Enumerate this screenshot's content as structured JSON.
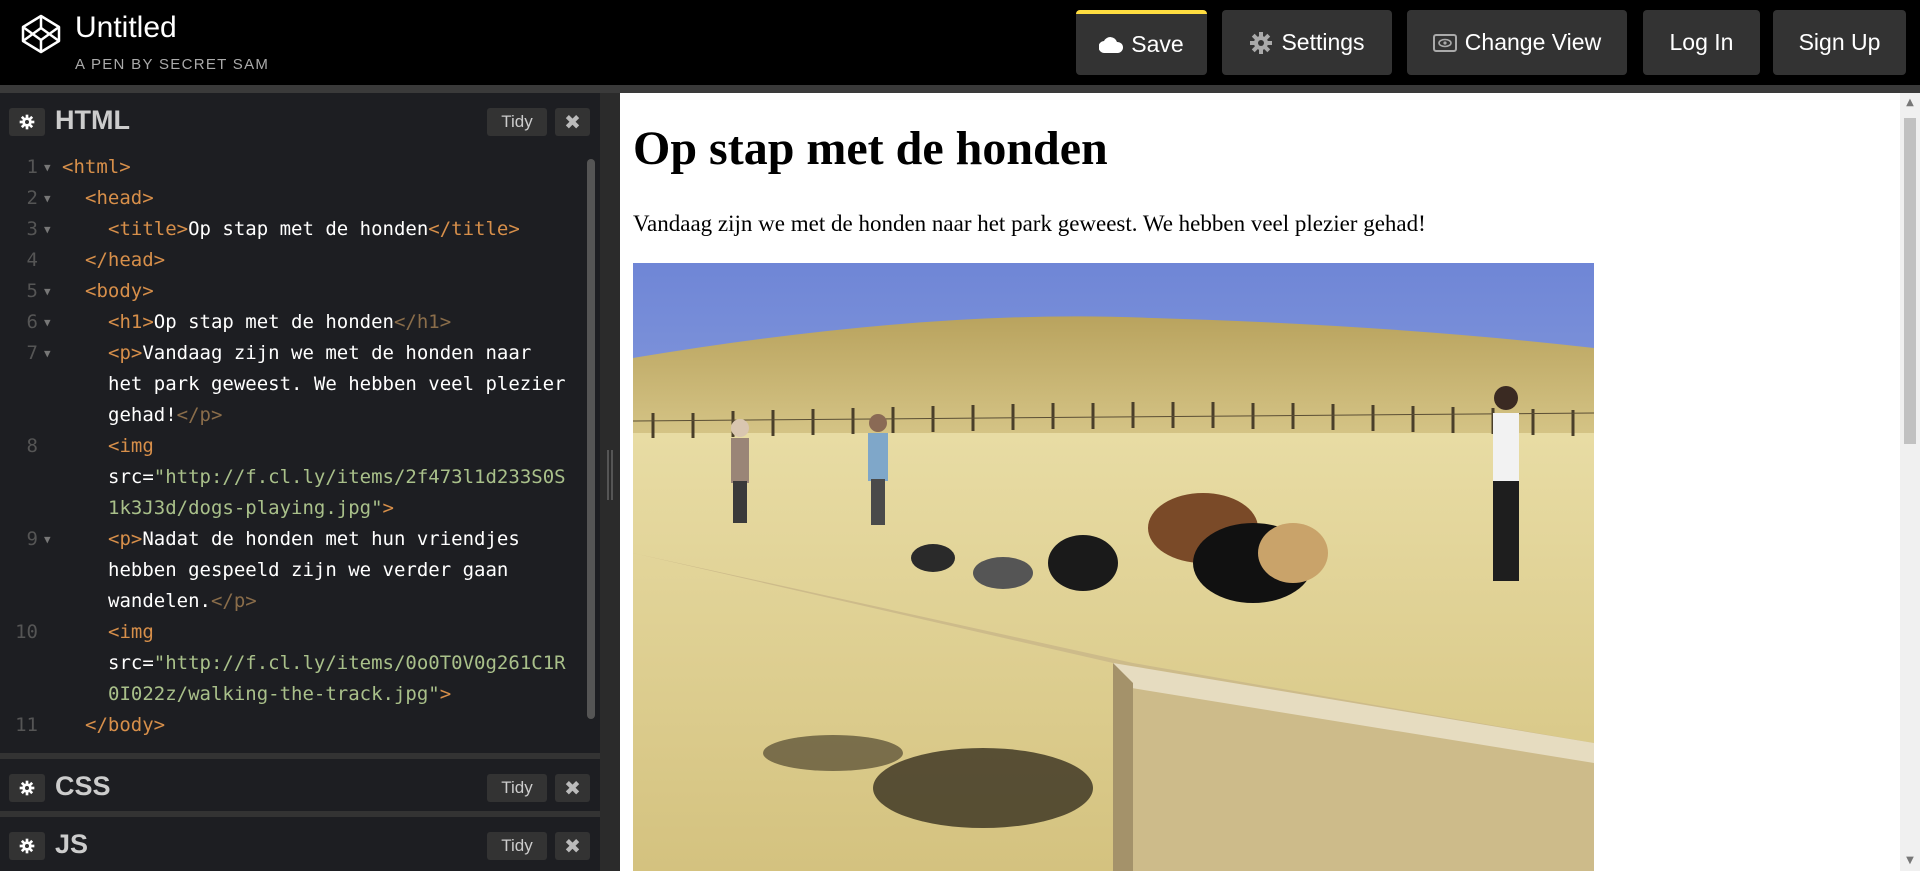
{
  "header": {
    "title": "Untitled",
    "subtitle": "A PEN BY SECRET SAM",
    "buttons": {
      "save": "Save",
      "settings": "Settings",
      "change_view": "Change View",
      "login": "Log In",
      "signup": "Sign Up"
    }
  },
  "editors": {
    "html": {
      "name": "HTML",
      "tidy": "Tidy",
      "close": "✖"
    },
    "css": {
      "name": "CSS",
      "tidy": "Tidy",
      "close": "✖"
    },
    "js": {
      "name": "JS",
      "tidy": "Tidy",
      "close": "✖"
    }
  },
  "code_lines": [
    {
      "n": "1",
      "fold": true
    },
    {
      "n": "2",
      "fold": true
    },
    {
      "n": "3",
      "fold": true
    },
    {
      "n": "4",
      "fold": false
    },
    {
      "n": "5",
      "fold": true
    },
    {
      "n": "6",
      "fold": true
    },
    {
      "n": "7",
      "fold": true
    },
    {
      "n": "",
      "fold": false
    },
    {
      "n": "",
      "fold": false
    },
    {
      "n": "8",
      "fold": false
    },
    {
      "n": "",
      "fold": false
    },
    {
      "n": "",
      "fold": false
    },
    {
      "n": "9",
      "fold": true
    },
    {
      "n": "",
      "fold": false
    },
    {
      "n": "",
      "fold": false
    },
    {
      "n": "10",
      "fold": false
    },
    {
      "n": "",
      "fold": false
    },
    {
      "n": "",
      "fold": false
    },
    {
      "n": "11",
      "fold": false
    }
  ],
  "code": {
    "l1_tag": "<html>",
    "l2_tag": "<head>",
    "l3_open": "<title>",
    "l3_text": "Op stap met de honden",
    "l3_close": "</title>",
    "l4_tag": "</head>",
    "l5_tag": "<body>",
    "l6_open": "<h1>",
    "l6_text": "Op stap met de honden",
    "l6_close": "</h1>",
    "l7_open": "<p>",
    "l7_text_a": "Vandaag zijn we met de honden naar",
    "l7_text_b": "het park geweest. We hebben veel plezier",
    "l7_text_c": "gehad!",
    "l7_close": "</p>",
    "l8_open": "<img",
    "l8_attr": "src=",
    "l8_str_a": "\"http://f.cl.ly/items/2f473l1d233S0S",
    "l8_str_b": "1k3J3d/dogs-playing.jpg\"",
    "l8_close": ">",
    "l9_open": "<p>",
    "l9_text_a": "Nadat de honden met hun vriendjes",
    "l9_text_b": "hebben gespeeld zijn we verder gaan",
    "l9_text_c": "wandelen.",
    "l9_close": "</p>",
    "l10_open": "<img",
    "l10_attr": "src=",
    "l10_str_a": "\"http://f.cl.ly/items/0o0T0V0g261C1R",
    "l10_str_b": "0I022z/walking-the-track.jpg\"",
    "l10_close": ">",
    "l11_tag": "</body>"
  },
  "preview": {
    "heading": "Op stap met de honden",
    "paragraph": "Vandaag zijn we met de honden naar het park geweest. We hebben veel plezier gehad!"
  },
  "colors": {
    "save_accent": "#ffdd40",
    "tag": "#d78f4a",
    "string": "#a9c08a"
  }
}
